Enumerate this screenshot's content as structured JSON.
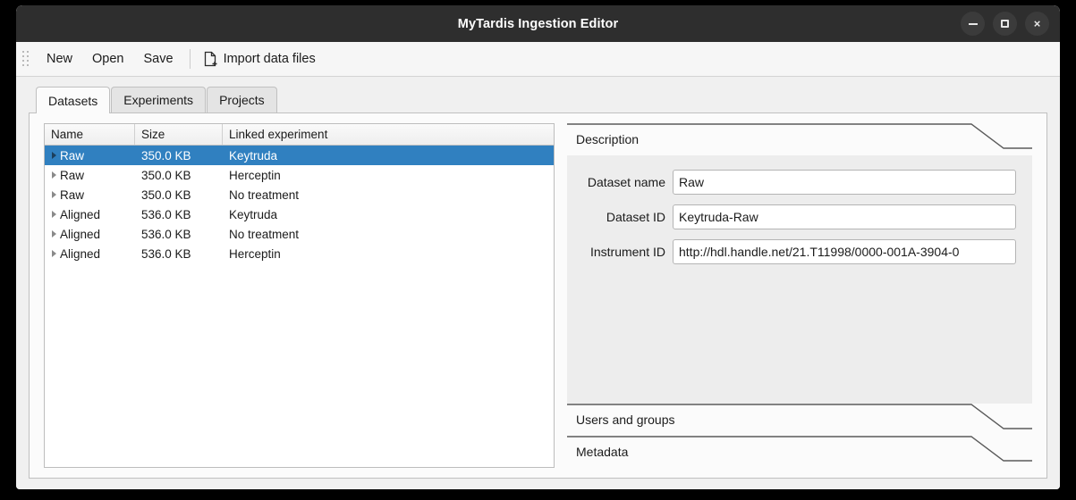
{
  "window": {
    "title": "MyTardis Ingestion Editor",
    "controls": [
      {
        "name": "minimize",
        "glyph": "minimize-icon"
      },
      {
        "name": "maximize",
        "glyph": "maximize-icon"
      },
      {
        "name": "close",
        "glyph": "close-icon",
        "label": "×"
      }
    ]
  },
  "toolbar": {
    "grip_icon": "drag-grip-icon",
    "new_label": "New",
    "open_label": "Open",
    "save_label": "Save",
    "import_label": "Import data files",
    "import_icon": "document-add-icon"
  },
  "tabs": [
    {
      "label": "Datasets",
      "active": true
    },
    {
      "label": "Experiments",
      "active": false
    },
    {
      "label": "Projects",
      "active": false
    }
  ],
  "table": {
    "columns": [
      "Name",
      "Size",
      "Linked experiment"
    ],
    "rows": [
      {
        "expander": "chevron-right-icon",
        "name": "Raw",
        "size": "350.0 KB",
        "experiment": "Keytruda",
        "selected": true
      },
      {
        "expander": "chevron-right-icon",
        "name": "Raw",
        "size": "350.0 KB",
        "experiment": "Herceptin",
        "selected": false
      },
      {
        "expander": "chevron-right-icon",
        "name": "Raw",
        "size": "350.0 KB",
        "experiment": "No treatment",
        "selected": false
      },
      {
        "expander": "chevron-right-icon",
        "name": "Aligned",
        "size": "536.0 KB",
        "experiment": "Keytruda",
        "selected": false
      },
      {
        "expander": "chevron-right-icon",
        "name": "Aligned",
        "size": "536.0 KB",
        "experiment": "No treatment",
        "selected": false
      },
      {
        "expander": "chevron-right-icon",
        "name": "Aligned",
        "size": "536.0 KB",
        "experiment": "Herceptin",
        "selected": false
      }
    ]
  },
  "details": {
    "description": {
      "header": "Description",
      "expanded": true,
      "fields": [
        {
          "label": "Dataset name",
          "value": "Raw"
        },
        {
          "label": "Dataset ID",
          "value": "Keytruda-Raw"
        },
        {
          "label": "Instrument ID",
          "value": "http://hdl.handle.net/21.T11998/0000-001A-3904-0"
        }
      ]
    },
    "users_and_groups": {
      "header": "Users and groups",
      "expanded": false
    },
    "metadata": {
      "header": "Metadata",
      "expanded": false
    }
  },
  "colors": {
    "titlebar": "#2e2e2e",
    "selection": "#3080c0",
    "window_bg": "#f0f0f0",
    "panel_bg": "#fbfbfb",
    "accordion_body": "#ededed"
  }
}
